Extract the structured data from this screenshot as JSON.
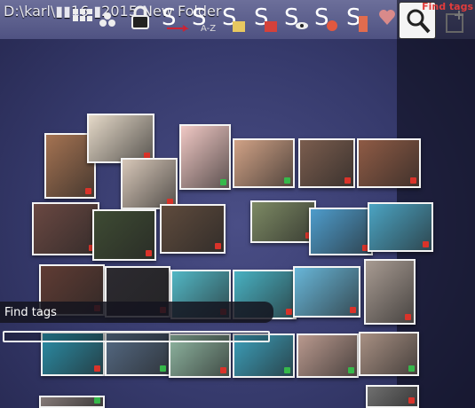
{
  "toolbar": {
    "path": "D:\\karl\\▮▮16 ▮2015 New Folder",
    "buttons": [
      {
        "name": "grid-view-icon"
      },
      {
        "name": "group-icon"
      },
      {
        "name": "lock-icon"
      },
      {
        "name": "sort-arrow-icon"
      },
      {
        "name": "sort-az-icon"
      },
      {
        "name": "sort-date-icon"
      },
      {
        "name": "sort-color-icon"
      },
      {
        "name": "sort-view-icon"
      },
      {
        "name": "sort-face-icon"
      },
      {
        "name": "sort-size-icon"
      }
    ],
    "tags_label": "Find tags"
  },
  "find": {
    "label": "Find tags",
    "value": ""
  },
  "colors": {
    "red": "#d9332a",
    "green": "#36b84a",
    "border": "#f4f4f4"
  },
  "photos": [
    {
      "tint": "#a57352",
      "dot": "red"
    },
    {
      "tint": "#e5d9c8",
      "dot": "red"
    },
    {
      "tint": "#d7c7b8",
      "dot": "red"
    },
    {
      "tint": "#f0c8c4",
      "dot": "green"
    },
    {
      "tint": "#d1a286",
      "dot": "green"
    },
    {
      "tint": "#7b5d4e",
      "dot": "red"
    },
    {
      "tint": "#8f5b45",
      "dot": "red"
    },
    {
      "tint": "#6a4842",
      "dot": "red"
    },
    {
      "tint": "#3e4b33",
      "dot": "red"
    },
    {
      "tint": "#5f4b3d",
      "dot": "red"
    },
    {
      "tint": "#7d8a64",
      "dot": "red"
    },
    {
      "tint": "#4e9ccb",
      "dot": "red"
    },
    {
      "tint": "#4ba4c3",
      "dot": "red"
    },
    {
      "tint": "#603c34",
      "dot": "red"
    },
    {
      "tint": "#2c2a30",
      "dot": "red"
    },
    {
      "tint": "#52b7c5",
      "dot": "red"
    },
    {
      "tint": "#48b1c2",
      "dot": "red"
    },
    {
      "tint": "#68b6d8",
      "dot": "red"
    },
    {
      "tint": "#a89b92",
      "dot": "red"
    },
    {
      "tint": "#2b8ea7",
      "dot": "red"
    },
    {
      "tint": "#556a84",
      "dot": "green"
    },
    {
      "tint": "#8fb6a1",
      "dot": "red"
    },
    {
      "tint": "#3c9fba",
      "dot": "green"
    },
    {
      "tint": "#b9998e",
      "dot": "green"
    },
    {
      "tint": "#a89083",
      "dot": "green"
    },
    {
      "tint": "#857a78",
      "dot": "green"
    },
    {
      "tint": "#707070",
      "dot": "red"
    }
  ]
}
